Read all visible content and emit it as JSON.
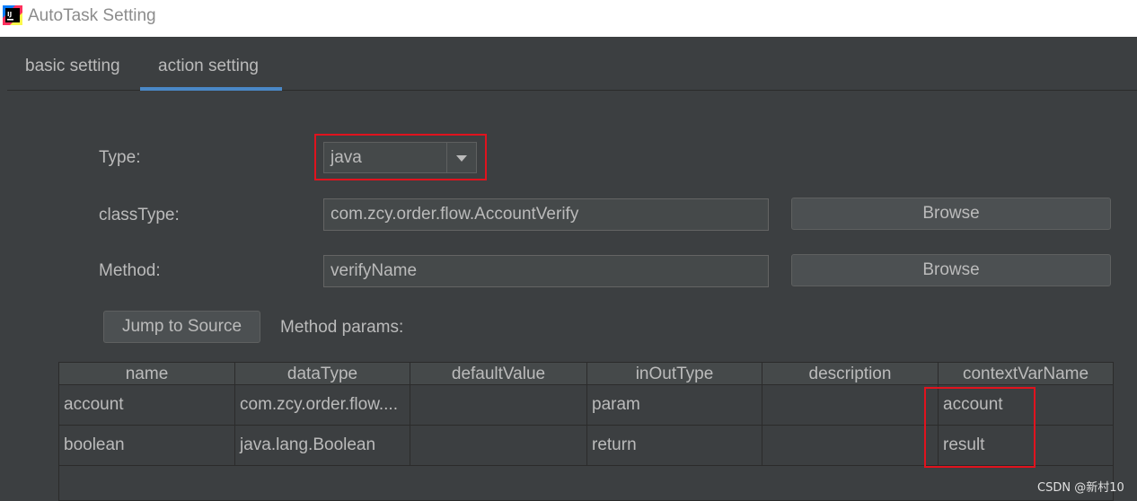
{
  "window": {
    "title": "AutoTask Setting",
    "app_icon": "intellij-idea-icon"
  },
  "tabs": [
    {
      "label": "basic setting",
      "active": false
    },
    {
      "label": "action setting",
      "active": true
    }
  ],
  "form": {
    "type_label": "Type:",
    "type_value": "java",
    "class_type_label": "classType:",
    "class_type_value": "com.zcy.order.flow.AccountVerify",
    "method_label": "Method:",
    "method_value": "verifyName",
    "browse_label": "Browse",
    "jump_label": "Jump to Source",
    "params_label": "Method params:"
  },
  "table": {
    "columns": [
      "name",
      "dataType",
      "defaultValue",
      "inOutType",
      "description",
      "contextVarName"
    ],
    "rows": [
      [
        "account",
        "com.zcy.order.flow....",
        "",
        "param",
        "",
        "account"
      ],
      [
        "boolean",
        "java.lang.Boolean",
        "",
        "return",
        "",
        "result"
      ]
    ]
  },
  "colors": {
    "accent": "#4a88c7",
    "highlight": "#e0131e",
    "background": "#3c3f41"
  },
  "watermark": "CSDN @新村10"
}
